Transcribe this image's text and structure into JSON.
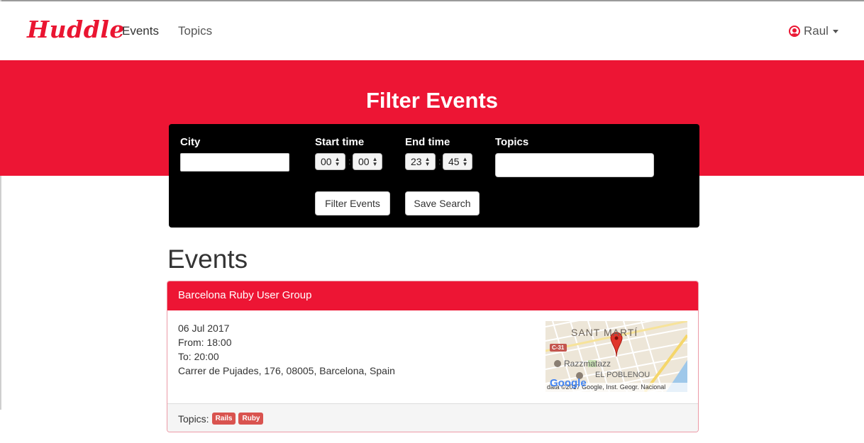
{
  "navbar": {
    "brand": "Huddle",
    "links": [
      {
        "label": "Events"
      },
      {
        "label": "Topics"
      }
    ],
    "user": "Raul"
  },
  "hero": {
    "title": "Filter Events"
  },
  "filter": {
    "city_label": "City",
    "city_value": "",
    "start_label": "Start time",
    "start_hour": "00",
    "start_minute": "00",
    "end_label": "End time",
    "end_hour": "23",
    "end_minute": "45",
    "topics_label": "Topics",
    "topics_value": "",
    "filter_button": "Filter Events",
    "save_button": "Save Search"
  },
  "events": {
    "heading": "Events",
    "items": [
      {
        "title": "Barcelona Ruby User Group",
        "date": "06 Jul 2017",
        "from": "From: 18:00",
        "to": "To: 20:00",
        "address": "Carrer de Pujades, 176, 08005, Barcelona, Spain",
        "topics_label": "Topics:",
        "topics": [
          "Rails",
          "Ruby"
        ],
        "map": {
          "district": "SANT MARTÍ",
          "road": "C-31",
          "venue": "Razzmatazz",
          "neighborhood": "EL POBLENOU",
          "logo": "Google",
          "attribution": "data ©2017 Google, Inst. Geogr. Nacional"
        }
      }
    ]
  },
  "colors": {
    "brand_red": "#ed1534",
    "panel_black": "#000000",
    "tag_red": "#d9534f"
  }
}
